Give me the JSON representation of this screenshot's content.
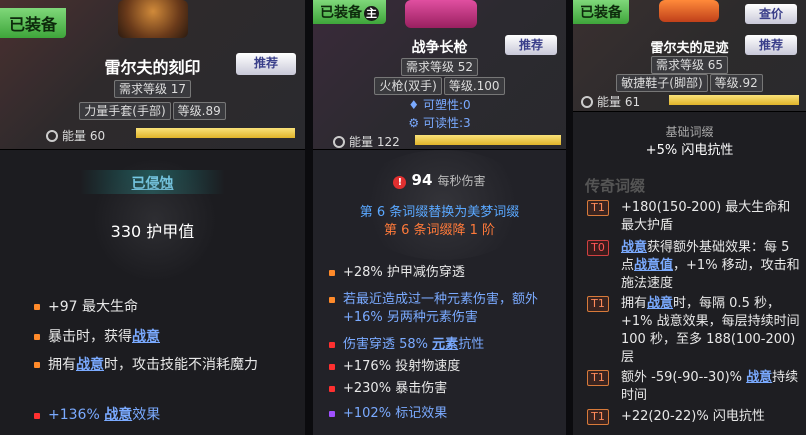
{
  "panel1": {
    "equipped": "已装备",
    "recommend": "推荐",
    "name": "雷尔夫的刻印",
    "req_level": "需求等级 17",
    "type": "力量手套(手部)",
    "item_level": "等级.89",
    "energy": "能量 60",
    "energy_fill": 1.0,
    "corrupted": "已侵蚀",
    "armor": "330 护甲值",
    "affixes": [
      {
        "text": "+97 最大生命",
        "color": "#ff8a2a"
      },
      {
        "pre": "暴击时，获得",
        "hl": "战意",
        "color": "#ff8a2a"
      },
      {
        "pre": "拥有",
        "hl": "战意",
        "post": "时，攻击技能不消耗魔力",
        "color": "#ff8a2a"
      },
      {
        "pre": "+136% ",
        "hl": "战意",
        "post": "效果",
        "color": "#ff3030"
      }
    ]
  },
  "panel2": {
    "equipped": "已装备",
    "main_mark": "主",
    "recommend": "推荐",
    "name": "战争长枪",
    "req_level": "需求等级 52",
    "type": "火枪(双手)",
    "item_level": "等级.100",
    "plasticity": "可塑性:0",
    "readability": "可读性:3",
    "energy": "能量 122",
    "energy_fill": 1.0,
    "dps_value": "94",
    "dps_label": "每秒伤害",
    "dream_note": "第 6 条词缀替换为美梦词缀",
    "tier_note": "第 6 条词缀降 1 阶",
    "affixes": [
      {
        "text": "+28% 护甲减伤穿透",
        "color": "#ff8a2a"
      },
      {
        "text": "若最近造成过一种元素伤害，额外 +16% 另两种元素伤害",
        "color": "#ff8a2a",
        "blue": true
      },
      {
        "pre": "伤害穿透 58% ",
        "hl2": "元素",
        "post": "抗性",
        "color": "#ff3030",
        "blue": true
      },
      {
        "text": "+176% 投射物速度",
        "color": "#ff3030"
      },
      {
        "text": "+230% 暴击伤害",
        "color": "#ff3030"
      },
      {
        "text": "+102% 标记效果",
        "color": "#a050ff",
        "blue": true
      }
    ]
  },
  "panel3": {
    "equipped": "已装备",
    "lookup": "查价",
    "recommend": "推荐",
    "name": "雷尔夫的足迹",
    "req_level": "需求等级 65",
    "type": "敏捷鞋子(脚部)",
    "item_level": "等级.92",
    "energy": "能量 61",
    "energy_fill": 1.0,
    "base_title": "基础词缀",
    "base_affix": "+5% 闪电抗性",
    "legend_title": "传奇词缀",
    "affixes": [
      {
        "tier": "T1",
        "text": "+180(150-200) 最大生命和最大护盾"
      },
      {
        "tier": "T0",
        "hl": "战意",
        "post": "获得额外基础效果：每 5 点",
        "hl_b": "战意值",
        "post2": "，+1% 移动，攻击和施法速度"
      },
      {
        "tier": "T1",
        "pre": "拥有",
        "hl": "战意",
        "post": "时，每隔 0.5 秒，+1% 战意效果，每层持续时间 100 秒，至多 188(100-200) 层"
      },
      {
        "tier": "T1",
        "pre": "额外 -59(-90--30)% ",
        "hl": "战意",
        "post": "持续时间"
      },
      {
        "tier": "T1",
        "text": "+22(20-22)% 闪电抗性"
      }
    ]
  }
}
